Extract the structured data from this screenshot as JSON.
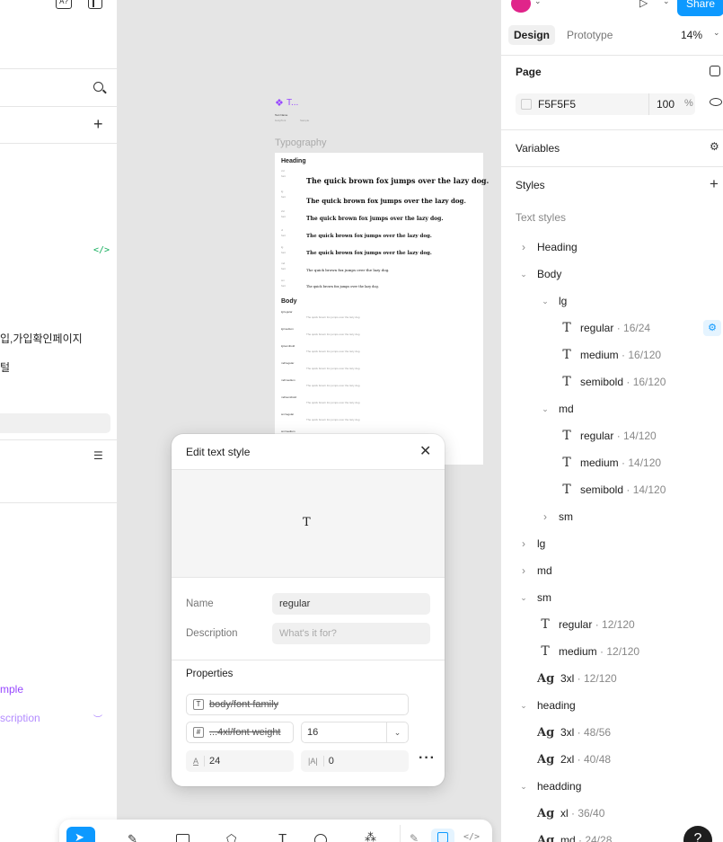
{
  "left_panel": {
    "korean_item1": "입,가입확인페이지",
    "korean_item2": "털",
    "link_example": "mple",
    "link_description": "scription"
  },
  "canvas": {
    "frame_title": "T...",
    "frame_label": "Typography",
    "heading_section": "Heading",
    "body_section": "Body",
    "sample_text": "The quick brown fox jumps over the lazy dog."
  },
  "dialog": {
    "title": "Edit text style",
    "preview_glyph": "T",
    "name_label": "Name",
    "name_value": "regular",
    "description_label": "Description",
    "description_placeholder": "What's it for?",
    "properties_label": "Properties",
    "font_family": "body/font family",
    "font_weight": "...4xl/font weight",
    "font_size": "16",
    "line_height": "24",
    "letter_spacing": "0"
  },
  "header": {
    "share_label": "Share",
    "tab_design": "Design",
    "tab_prototype": "Prototype",
    "zoom": "14%"
  },
  "page_section": {
    "title": "Page",
    "color_hex": "F5F5F5",
    "opacity": "100",
    "opacity_unit": "%"
  },
  "variables_title": "Variables",
  "styles_title": "Styles",
  "text_styles_label": "Text styles",
  "text_styles": [
    {
      "kind": "group",
      "name": "Heading",
      "meta": "",
      "expanded": false,
      "indent": 0
    },
    {
      "kind": "group",
      "name": "Body",
      "meta": "",
      "expanded": true,
      "indent": 0
    },
    {
      "kind": "group",
      "name": "lg",
      "meta": "",
      "expanded": true,
      "indent": 1
    },
    {
      "kind": "t",
      "name": "regular",
      "meta": " · 16/24",
      "indent": 2,
      "selected": true
    },
    {
      "kind": "t",
      "name": "medium",
      "meta": " · 16/120",
      "indent": 2
    },
    {
      "kind": "t",
      "name": "semibold",
      "meta": " · 16/120",
      "indent": 2
    },
    {
      "kind": "group",
      "name": "md",
      "meta": "",
      "expanded": true,
      "indent": 1
    },
    {
      "kind": "t",
      "name": "regular",
      "meta": " · 14/120",
      "indent": 2
    },
    {
      "kind": "t",
      "name": "medium",
      "meta": " · 14/120",
      "indent": 2
    },
    {
      "kind": "t",
      "name": "semibold",
      "meta": " · 14/120",
      "indent": 2
    },
    {
      "kind": "group",
      "name": "sm",
      "meta": "",
      "expanded": false,
      "indent": 1
    },
    {
      "kind": "group",
      "name": "lg",
      "meta": "",
      "expanded": false,
      "indent": 0
    },
    {
      "kind": "group",
      "name": "md",
      "meta": "",
      "expanded": false,
      "indent": 0
    },
    {
      "kind": "group",
      "name": "sm",
      "meta": "",
      "expanded": true,
      "indent": 0
    },
    {
      "kind": "t",
      "name": "regular",
      "meta": " · 12/120",
      "indent": 1
    },
    {
      "kind": "t",
      "name": "medium",
      "meta": " · 12/120",
      "indent": 1
    },
    {
      "kind": "ag",
      "name": "3xl",
      "meta": " · 12/120",
      "indent": 1
    },
    {
      "kind": "group",
      "name": "heading",
      "meta": "",
      "expanded": true,
      "indent": 0
    },
    {
      "kind": "ag",
      "name": "3xl",
      "meta": " · 48/56",
      "indent": 1
    },
    {
      "kind": "ag",
      "name": "2xl",
      "meta": " · 40/48",
      "indent": 1
    },
    {
      "kind": "group",
      "name": "headding",
      "meta": "",
      "expanded": true,
      "indent": 0
    },
    {
      "kind": "ag",
      "name": "xl",
      "meta": " · 36/40",
      "indent": 1
    },
    {
      "kind": "ag",
      "name": "md",
      "meta": " · 24/28",
      "indent": 1
    }
  ],
  "help_label": "?",
  "colors": {
    "accent": "#0d99ff",
    "code_green": "#14ae5c",
    "purple": "#9747ff"
  }
}
